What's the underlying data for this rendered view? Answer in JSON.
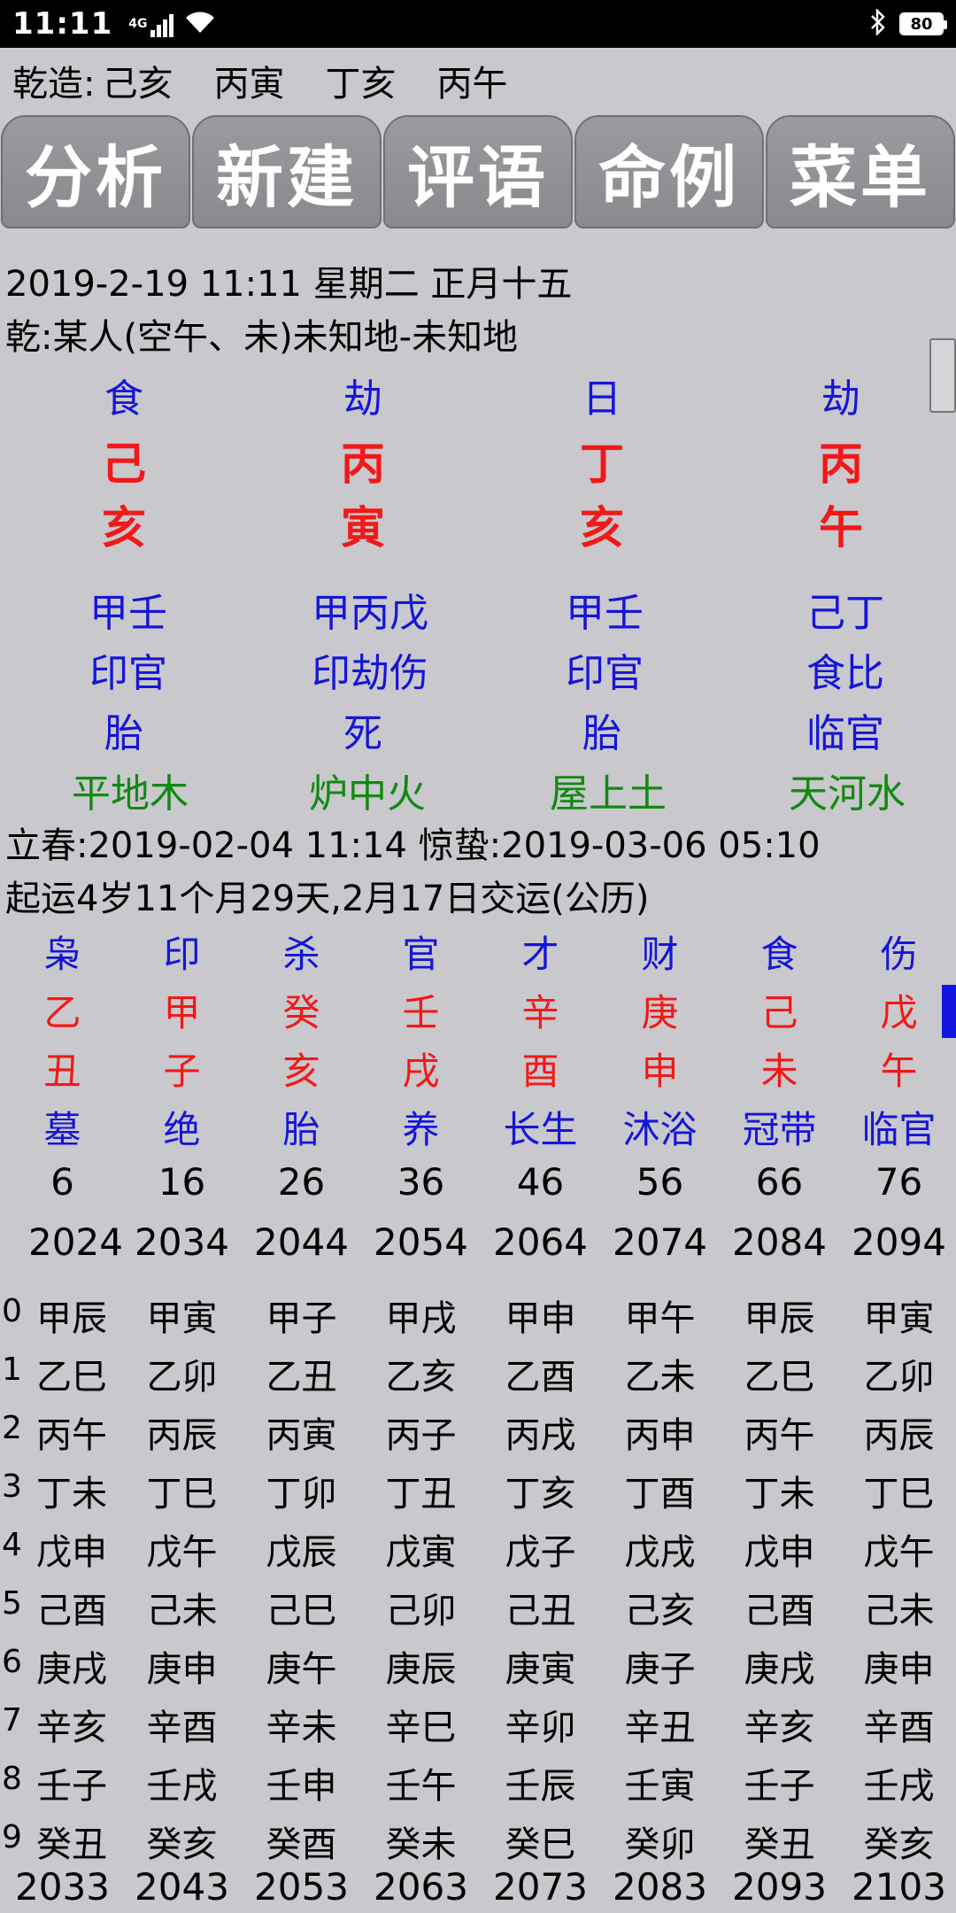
{
  "status": {
    "time": "11:11",
    "network": "4G",
    "battery": "80"
  },
  "header": {
    "items": [
      "乾造:",
      "己亥",
      "丙寅",
      "丁亥",
      "丙午"
    ]
  },
  "tabs": [
    "分析",
    "新建",
    "评语",
    "命例",
    "菜单"
  ],
  "info": {
    "date_line": "2019-2-19 11:11  星期二  正月十五",
    "person_line": "乾:某人(空午、未)未知地-未知地"
  },
  "pillars": {
    "shishen": [
      "食",
      "劫",
      "日",
      "劫"
    ],
    "tiangan": [
      "己",
      "丙",
      "丁",
      "丙"
    ],
    "dizhi": [
      "亥",
      "寅",
      "亥",
      "午"
    ],
    "canggan": [
      "甲壬",
      "甲丙戊",
      "甲壬",
      "己丁"
    ],
    "canggan_shishen": [
      "印官",
      "印劫伤",
      "印官",
      "食比"
    ],
    "changsheng": [
      "胎",
      "死",
      "胎",
      "临官"
    ],
    "nayin": [
      "平地木",
      "炉中火",
      "屋上土",
      "天河水"
    ]
  },
  "jieqi_line": "立春:2019-02-04 11:14  惊蛰:2019-03-06 05:10",
  "qiyun_line": "起运4岁11个月29天,2月17日交运(公历)",
  "dayun": {
    "shishen": [
      "枭",
      "印",
      "杀",
      "官",
      "才",
      "财",
      "食",
      "伤"
    ],
    "tiangan": [
      "乙",
      "甲",
      "癸",
      "壬",
      "辛",
      "庚",
      "己",
      "戊"
    ],
    "dizhi": [
      "丑",
      "子",
      "亥",
      "戌",
      "酉",
      "申",
      "未",
      "午"
    ],
    "changsheng": [
      "墓",
      "绝",
      "胎",
      "养",
      "长生",
      "沐浴",
      "冠带",
      "临官"
    ],
    "ages": [
      "6",
      "16",
      "26",
      "36",
      "46",
      "56",
      "66",
      "76"
    ],
    "years": [
      "2024",
      "2034",
      "2044",
      "2054",
      "2064",
      "2074",
      "2084",
      "2094"
    ]
  },
  "liunian": {
    "indices": [
      "0",
      "1",
      "2",
      "3",
      "4",
      "5",
      "6",
      "7",
      "8",
      "9"
    ],
    "rows": [
      [
        "甲辰",
        "甲寅",
        "甲子",
        "甲戌",
        "甲申",
        "甲午",
        "甲辰",
        "甲寅"
      ],
      [
        "乙巳",
        "乙卯",
        "乙丑",
        "乙亥",
        "乙酉",
        "乙未",
        "乙巳",
        "乙卯"
      ],
      [
        "丙午",
        "丙辰",
        "丙寅",
        "丙子",
        "丙戌",
        "丙申",
        "丙午",
        "丙辰"
      ],
      [
        "丁未",
        "丁巳",
        "丁卯",
        "丁丑",
        "丁亥",
        "丁酉",
        "丁未",
        "丁巳"
      ],
      [
        "戊申",
        "戊午",
        "戊辰",
        "戊寅",
        "戊子",
        "戊戌",
        "戊申",
        "戊午"
      ],
      [
        "己酉",
        "己未",
        "己巳",
        "己卯",
        "己丑",
        "己亥",
        "己酉",
        "己未"
      ],
      [
        "庚戌",
        "庚申",
        "庚午",
        "庚辰",
        "庚寅",
        "庚子",
        "庚戌",
        "庚申"
      ],
      [
        "辛亥",
        "辛酉",
        "辛未",
        "辛巳",
        "辛卯",
        "辛丑",
        "辛亥",
        "辛酉"
      ],
      [
        "壬子",
        "壬戌",
        "壬申",
        "壬午",
        "壬辰",
        "壬寅",
        "壬子",
        "壬戌"
      ],
      [
        "癸丑",
        "癸亥",
        "癸酉",
        "癸未",
        "癸巳",
        "癸卯",
        "癸丑",
        "癸亥"
      ]
    ],
    "end_years": [
      "2033",
      "2043",
      "2053",
      "2063",
      "2073",
      "2083",
      "2093",
      "2103"
    ]
  }
}
